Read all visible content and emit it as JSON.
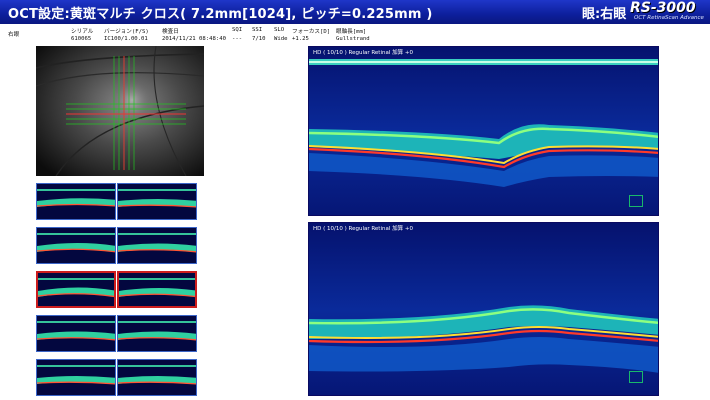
{
  "title": "OCT設定:黄斑マルチ クロス( 7.2mm[1024], ピッチ=0.225mm )",
  "eye": "眼:右眼",
  "logo": {
    "main": "RS-3000",
    "sub": "OCT RetinaScan Advance"
  },
  "info": {
    "eye_label": "右眼",
    "serial_label": "シリアル",
    "serial_value": "610065",
    "version_label": "バージョン(F/S)",
    "version_value": "IC100/1.00.01",
    "date_label": "検査日",
    "date_value": "2014/11/21 08:48:40",
    "sq_label": "SQI",
    "sq_value": "---",
    "ssi_label": "SSI",
    "ssi_value": "7/10",
    "slo_label": "SLO",
    "slo_value": "Wide",
    "focus_label": "フォーカス[D]",
    "focus_value": "+1.25",
    "axial_label": "眼軸長[mm]",
    "axial_value": "Gullstrand"
  },
  "bscans": [
    {
      "label": "HD ( 10/10 ) Regular Retinal 加算 +0"
    },
    {
      "label": "HD ( 10/10 ) Regular Retinal 加算 +0"
    }
  ],
  "colors": {
    "titlebar": "#0d1f9c",
    "scan_bg": "#000060",
    "selected_border": "#cc1d1d",
    "thumb_border": "#3c66c9"
  }
}
